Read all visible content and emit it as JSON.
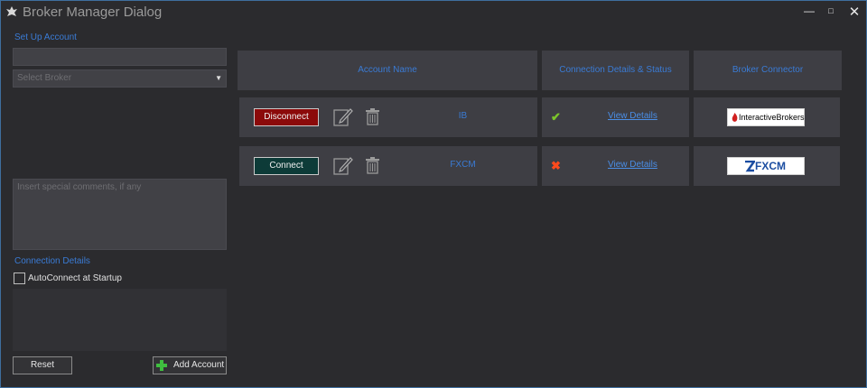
{
  "window": {
    "title": "Broker Manager Dialog",
    "controls": {
      "minimize": "—",
      "maximize": "□",
      "close": "✕"
    }
  },
  "setup": {
    "section_label": "Set Up Account",
    "account_input_value": "",
    "broker_placeholder": "Select Broker",
    "comments_placeholder": "Insert special comments, if any"
  },
  "connection": {
    "section_label": "Connection Details",
    "autoconnect_label": "AutoConnect at Startup",
    "autoconnect_checked": false
  },
  "buttons": {
    "reset": "Reset",
    "add_account": "Add Account"
  },
  "table": {
    "headers": {
      "account_name": "Account Name",
      "status": "Connection Details & Status",
      "broker": "Broker Connector"
    },
    "rows": [
      {
        "action": "Disconnect",
        "name": "IB",
        "status": "connected",
        "status_icon": "✔",
        "link": "View Details",
        "broker_logo": "InteractiveBrokers"
      },
      {
        "action": "Connect",
        "name": "FXCM",
        "status": "disconnected",
        "status_icon": "✖",
        "link": "View Details",
        "broker_logo": "FXCM"
      }
    ]
  },
  "colors": {
    "accent": "#3a7bd5",
    "disconnect_button": "#8b0a0a",
    "connect_button": "#0d3b38",
    "ok": "#7cc52b",
    "fail": "#ff4a1c"
  }
}
